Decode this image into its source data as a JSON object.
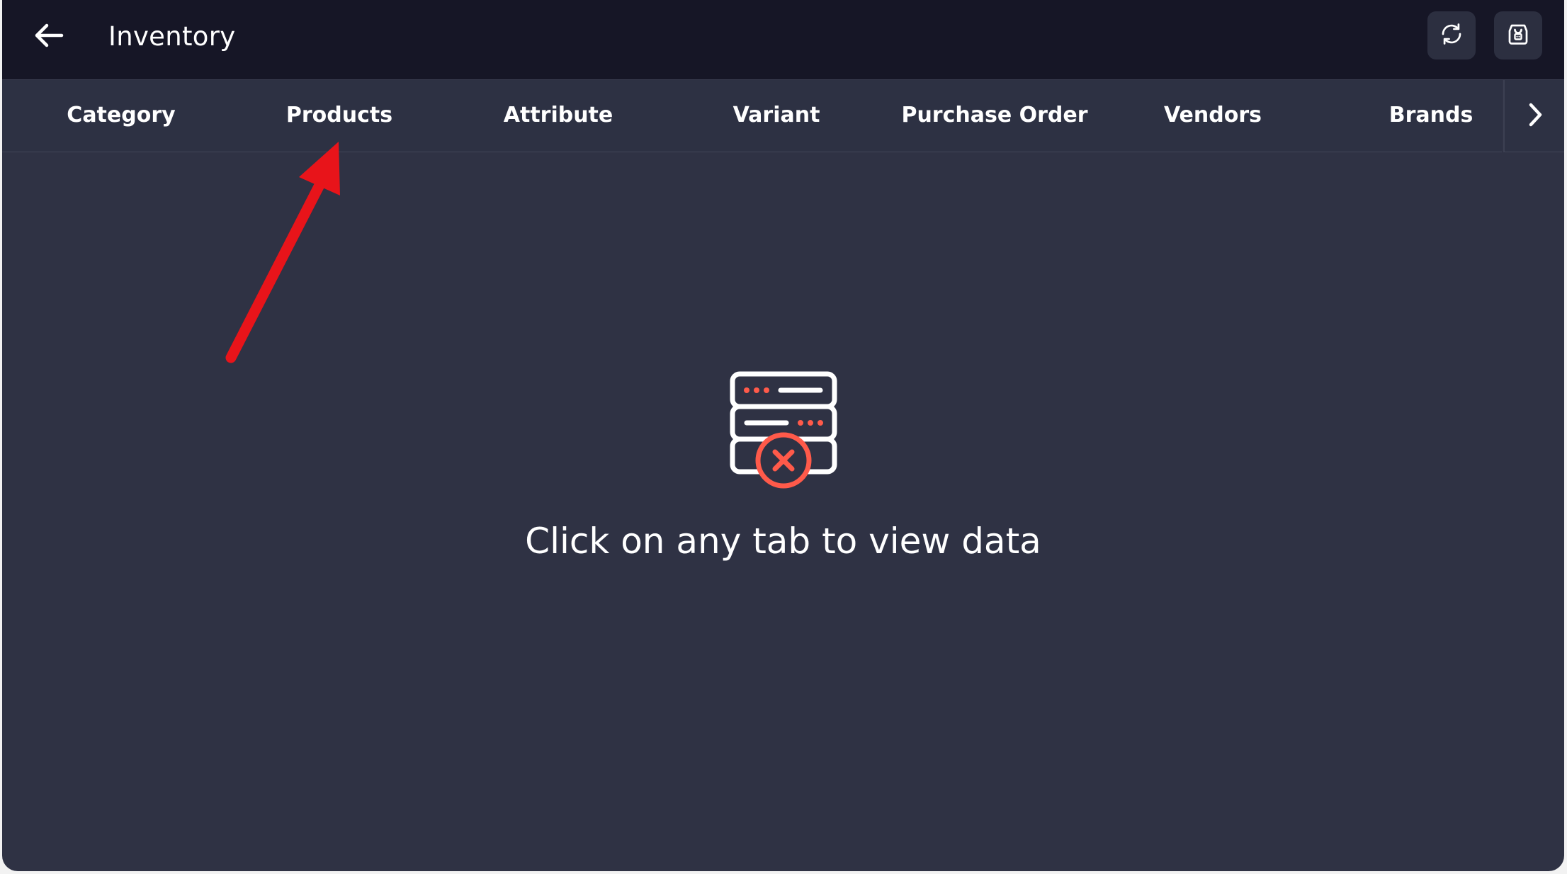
{
  "header": {
    "title": "Inventory",
    "back_icon": "arrow-left-icon",
    "refresh_icon": "refresh-icon",
    "store_icon": "store-icon"
  },
  "tabs": [
    {
      "label": "Category"
    },
    {
      "label": "Products"
    },
    {
      "label": "Attribute"
    },
    {
      "label": "Variant"
    },
    {
      "label": "Purchase Order"
    },
    {
      "label": "Vendors"
    },
    {
      "label": "Brands"
    }
  ],
  "tab_next_icon": "chevron-right-icon",
  "empty_state": {
    "icon": "server-error-icon",
    "message": "Click on any tab to view data"
  },
  "colors": {
    "topbar_bg": "#161626",
    "content_bg": "#2f3244",
    "accent": "#ff5a4a",
    "annotation_arrow": "#e8141a"
  }
}
